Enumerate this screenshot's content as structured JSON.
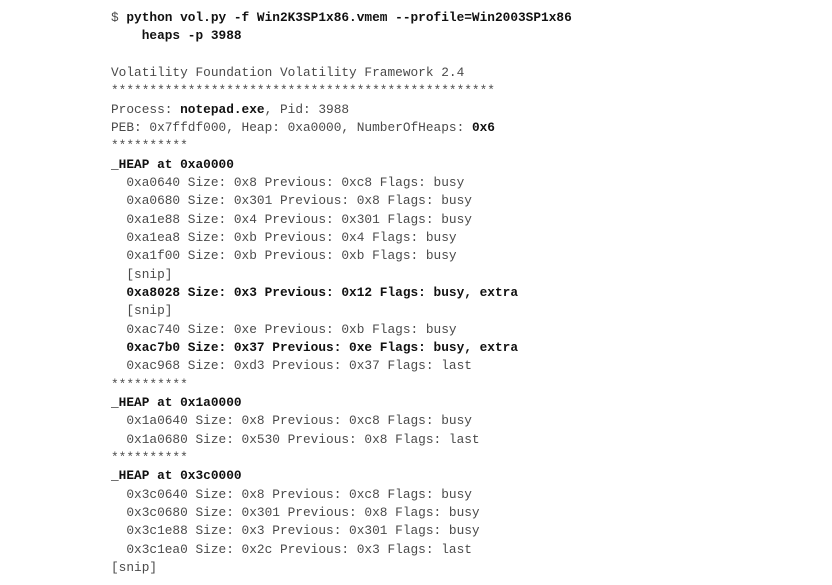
{
  "command": [
    [
      {
        "t": "$ ",
        "b": false
      },
      {
        "t": "python vol.py -f Win2K3SP1x86.vmem --profile=Win2003SP1x86",
        "b": true
      }
    ],
    [
      {
        "t": "    ",
        "b": false
      },
      {
        "t": "heaps -p 3988",
        "b": true
      }
    ],
    [
      {
        "t": "",
        "b": false
      }
    ]
  ],
  "output": [
    [
      {
        "t": "Volatility Foundation Volatility Framework 2.4",
        "b": false
      }
    ],
    [
      {
        "t": "**************************************************",
        "b": false
      }
    ],
    [
      {
        "t": "Process: ",
        "b": false
      },
      {
        "t": "notepad.exe",
        "b": true
      },
      {
        "t": ", Pid: 3988",
        "b": false
      }
    ],
    [
      {
        "t": "PEB: 0x7ffdf000, Heap: 0xa0000, NumberOfHeaps: ",
        "b": false
      },
      {
        "t": "0x6",
        "b": true
      }
    ],
    [
      {
        "t": "**********",
        "b": false
      }
    ],
    [
      {
        "t": "_HEAP at 0xa0000",
        "b": true
      }
    ],
    [
      {
        "t": "  0xa0640 Size: 0x8 Previous: 0xc8 Flags: busy",
        "b": false
      }
    ],
    [
      {
        "t": "  0xa0680 Size: 0x301 Previous: 0x8 Flags: busy",
        "b": false
      }
    ],
    [
      {
        "t": "  0xa1e88 Size: 0x4 Previous: 0x301 Flags: busy",
        "b": false
      }
    ],
    [
      {
        "t": "  0xa1ea8 Size: 0xb Previous: 0x4 Flags: busy",
        "b": false
      }
    ],
    [
      {
        "t": "  0xa1f00 Size: 0xb Previous: 0xb Flags: busy",
        "b": false
      }
    ],
    [
      {
        "t": "  [snip]",
        "b": false
      }
    ],
    [
      {
        "t": "  ",
        "b": false
      },
      {
        "t": "0xa8028 Size: 0x3 Previous: 0x12 Flags: busy, extra",
        "b": true
      }
    ],
    [
      {
        "t": "  [snip]",
        "b": false
      }
    ],
    [
      {
        "t": "  0xac740 Size: 0xe Previous: 0xb Flags: busy",
        "b": false
      }
    ],
    [
      {
        "t": "  ",
        "b": false
      },
      {
        "t": "0xac7b0 Size: 0x37 Previous: 0xe Flags: busy, extra",
        "b": true
      }
    ],
    [
      {
        "t": "  0xac968 Size: 0xd3 Previous: 0x37 Flags: last",
        "b": false
      }
    ],
    [
      {
        "t": "**********",
        "b": false
      }
    ],
    [
      {
        "t": "_HEAP at 0x1a0000",
        "b": true
      }
    ],
    [
      {
        "t": "  0x1a0640 Size: 0x8 Previous: 0xc8 Flags: busy",
        "b": false
      }
    ],
    [
      {
        "t": "  0x1a0680 Size: 0x530 Previous: 0x8 Flags: last",
        "b": false
      }
    ],
    [
      {
        "t": "**********",
        "b": false
      }
    ],
    [
      {
        "t": "_HEAP at 0x3c0000",
        "b": true
      }
    ],
    [
      {
        "t": "  0x3c0640 Size: 0x8 Previous: 0xc8 Flags: busy",
        "b": false
      }
    ],
    [
      {
        "t": "  0x3c0680 Size: 0x301 Previous: 0x8 Flags: busy",
        "b": false
      }
    ],
    [
      {
        "t": "  0x3c1e88 Size: 0x3 Previous: 0x301 Flags: busy",
        "b": false
      }
    ],
    [
      {
        "t": "  0x3c1ea0 Size: 0x2c Previous: 0x3 Flags: last",
        "b": false
      }
    ],
    [
      {
        "t": "[snip]",
        "b": false
      }
    ]
  ]
}
